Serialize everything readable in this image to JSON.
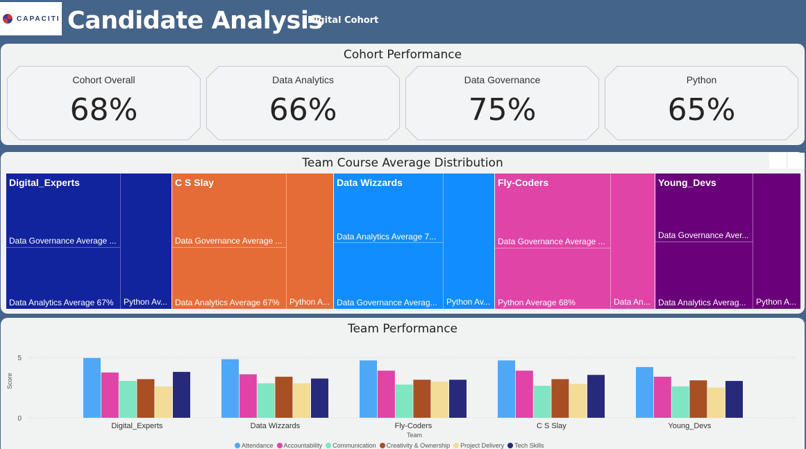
{
  "header": {
    "logo_text": "CAPACITI",
    "title": "Candidate Analysis",
    "subtitle": "Digital Cohort"
  },
  "cohort_performance": {
    "title": "Cohort Performance",
    "cards": [
      {
        "label": "Cohort Overall",
        "value": "68%"
      },
      {
        "label": "Data Analytics",
        "value": "66%"
      },
      {
        "label": "Data Governance",
        "value": "75%"
      },
      {
        "label": "Python",
        "value": "65%"
      }
    ]
  },
  "treemap": {
    "title": "Team Course Average Distribution",
    "teams": [
      {
        "name": "Digital_Experts",
        "color": "#12239e",
        "cells": [
          "Data Governance Average ...",
          "Data Analytics Average 67%",
          "Python Av..."
        ]
      },
      {
        "name": "C S Slay",
        "color": "#e66c37",
        "cells": [
          "Data Governance Average ...",
          "Data Analytics Average 67%",
          "Python A..."
        ]
      },
      {
        "name": "Data Wizzards",
        "color": "#118dff",
        "cells": [
          "Data Analytics Average 7...",
          "Data Governance Averag...",
          "Python Av..."
        ]
      },
      {
        "name": "Fly-Coders",
        "color": "#e044a7",
        "cells": [
          "Data Governance Average ...",
          "Python Average 68%",
          "Data An..."
        ]
      },
      {
        "name": "Young_Devs",
        "color": "#6b007b",
        "cells": [
          "Data Governance Aver...",
          "Data Analytics Averag...",
          "Python A..."
        ]
      }
    ]
  },
  "team_performance": {
    "title": "Team Performance"
  },
  "chart_data": {
    "type": "bar",
    "title": "Team Performance",
    "xlabel": "Team",
    "ylabel": "Score",
    "ylim": [
      0,
      5.5
    ],
    "yticks": [
      0,
      5
    ],
    "grid": true,
    "legend_position": "bottom",
    "categories": [
      "Digital_Experts",
      "Data Wizzards",
      "Fly-Coders",
      "C S Slay",
      "Young_Devs"
    ],
    "series": [
      {
        "name": "Attendance",
        "color": "#4ea8f7",
        "values": [
          4.95,
          4.85,
          4.75,
          4.75,
          4.2
        ]
      },
      {
        "name": "Accountability",
        "color": "#e044a7",
        "values": [
          3.75,
          3.6,
          3.9,
          3.9,
          3.4
        ]
      },
      {
        "name": "Communication",
        "color": "#7fe5c2",
        "values": [
          3.05,
          2.85,
          2.75,
          2.65,
          2.6
        ]
      },
      {
        "name": "Creativity & Ownership",
        "color": "#a94f24",
        "values": [
          3.2,
          3.4,
          3.15,
          3.2,
          3.1
        ]
      },
      {
        "name": "Project Delivery",
        "color": "#f2dc96",
        "values": [
          2.6,
          2.85,
          3.0,
          2.8,
          2.5
        ]
      },
      {
        "name": "Tech Skills",
        "color": "#272a7a",
        "values": [
          3.8,
          3.25,
          3.15,
          3.55,
          3.05
        ]
      }
    ]
  }
}
